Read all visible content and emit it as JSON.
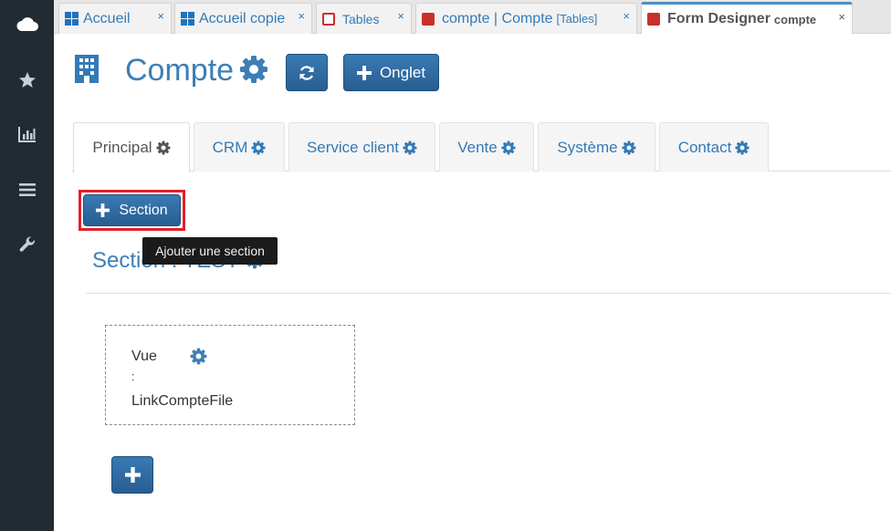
{
  "sidebar": {
    "items": [
      {
        "icon": "cloud-icon"
      },
      {
        "icon": "star-icon"
      },
      {
        "icon": "bar-chart-icon"
      },
      {
        "icon": "list-icon"
      },
      {
        "icon": "wrench-icon"
      }
    ]
  },
  "browser_tabs": [
    {
      "label": "Accueil",
      "suffix": "",
      "icon": "windows-icon",
      "close": "×"
    },
    {
      "label": "Accueil copie",
      "suffix": "",
      "icon": "windows-icon",
      "close": "×"
    },
    {
      "label": "Tables",
      "suffix": "",
      "icon": "table-outline-icon",
      "close": "×"
    },
    {
      "label": "compte | Compte",
      "suffix": "[Tables]",
      "icon": "red-square-icon",
      "close": "×"
    },
    {
      "label": "Form Designer",
      "suffix": "compte",
      "icon": "red-square-icon",
      "close": "×",
      "active": true
    }
  ],
  "header": {
    "title": "Compte",
    "onglet_label": "Onglet",
    "colors": {
      "primary": "#2d6a9f",
      "title": "#3c7fb6",
      "highlight": "#e0202a"
    }
  },
  "page_tabs": [
    {
      "label": "Principal",
      "active": true
    },
    {
      "label": "CRM"
    },
    {
      "label": "Service client"
    },
    {
      "label": "Vente"
    },
    {
      "label": "Système"
    },
    {
      "label": "Contact"
    }
  ],
  "section": {
    "button_label": "Section",
    "tooltip": "Ajouter une section",
    "title": "Section : TEST"
  },
  "field": {
    "line1": "Vue",
    "line2": ":",
    "line3": "LinkCompteFile"
  }
}
